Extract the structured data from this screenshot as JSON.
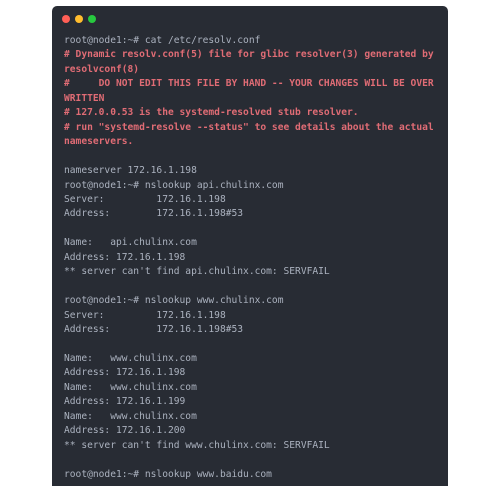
{
  "window_controls": {
    "close_color": "#ff5f56",
    "minimize_color": "#ffbd2e",
    "maximize_color": "#27c93f"
  },
  "colors": {
    "background": "#282c34",
    "text": "#abb2bf",
    "comment": "#e06c75"
  },
  "lines": [
    {
      "text": "root@node1:~# cat /etc/resolv.conf",
      "type": "normal"
    },
    {
      "text": "# Dynamic resolv.conf(5) file for glibc resolver(3) generated by resolvconf(8)",
      "type": "comment"
    },
    {
      "text": "#     DO NOT EDIT THIS FILE BY HAND -- YOUR CHANGES WILL BE OVERWRITTEN",
      "type": "comment"
    },
    {
      "text": "# 127.0.0.53 is the systemd-resolved stub resolver.",
      "type": "comment"
    },
    {
      "text": "# run \"systemd-resolve --status\" to see details about the actual nameservers.",
      "type": "comment"
    },
    {
      "text": "",
      "type": "normal"
    },
    {
      "text": "nameserver 172.16.1.198",
      "type": "normal"
    },
    {
      "text": "root@node1:~# nslookup api.chulinx.com",
      "type": "normal"
    },
    {
      "text": "Server:         172.16.1.198",
      "type": "normal"
    },
    {
      "text": "Address:        172.16.1.198#53",
      "type": "normal"
    },
    {
      "text": "",
      "type": "normal"
    },
    {
      "text": "Name:   api.chulinx.com",
      "type": "normal"
    },
    {
      "text": "Address: 172.16.1.198",
      "type": "normal"
    },
    {
      "text": "** server can't find api.chulinx.com: SERVFAIL",
      "type": "normal"
    },
    {
      "text": "",
      "type": "normal"
    },
    {
      "text": "root@node1:~# nslookup www.chulinx.com",
      "type": "normal"
    },
    {
      "text": "Server:         172.16.1.198",
      "type": "normal"
    },
    {
      "text": "Address:        172.16.1.198#53",
      "type": "normal"
    },
    {
      "text": "",
      "type": "normal"
    },
    {
      "text": "Name:   www.chulinx.com",
      "type": "normal"
    },
    {
      "text": "Address: 172.16.1.198",
      "type": "normal"
    },
    {
      "text": "Name:   www.chulinx.com",
      "type": "normal"
    },
    {
      "text": "Address: 172.16.1.199",
      "type": "normal"
    },
    {
      "text": "Name:   www.chulinx.com",
      "type": "normal"
    },
    {
      "text": "Address: 172.16.1.200",
      "type": "normal"
    },
    {
      "text": "** server can't find www.chulinx.com: SERVFAIL",
      "type": "normal"
    },
    {
      "text": "",
      "type": "normal"
    },
    {
      "text": "root@node1:~# nslookup www.baidu.com",
      "type": "normal"
    }
  ]
}
